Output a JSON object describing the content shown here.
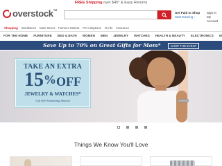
{
  "promo": {
    "highlight": "FREE Shipping",
    "rest": " over $45* & Easy Returns"
  },
  "brand": {
    "name": "overstock",
    "tm": "TM"
  },
  "search": {
    "placeholder": ""
  },
  "account": {
    "paid_title": "Get Paid to Shop",
    "paid_link": "Start Earning ›",
    "signin_line1": "Sign In",
    "signin_line2": "My Account"
  },
  "subnav": [
    "Shopping",
    "Worldstock",
    "Main Street",
    "Farmers Market",
    "Pet Adoptions",
    "O.info",
    "Insurance"
  ],
  "categories": [
    "FOR THE HOME",
    "FURNITURE",
    "BED & BATH",
    "WOMEN",
    "MEN",
    "JEWELRY",
    "WATCHES",
    "HEALTH & BEAUTY",
    "ELECTRONICS",
    "WO"
  ],
  "banner": {
    "text": "Save Up to 70% on Great Gifts for Mom*",
    "button": "SHOP THE EVENT"
  },
  "hero": {
    "line1": "TAKE AN EXTRA",
    "number": "15",
    "percent": "%",
    "off": "OFF",
    "line3": "JEWELRY & WATCHES*",
    "line4": "Gift Her Something Special"
  },
  "carousel": {
    "active_index": 0,
    "count": 4
  },
  "section": {
    "title": "Things We Know You'll Love"
  },
  "colors": {
    "brand_red": "#d11f28",
    "banner_blue": "#2c4b7d",
    "hero_card": "#bfe0ea"
  }
}
